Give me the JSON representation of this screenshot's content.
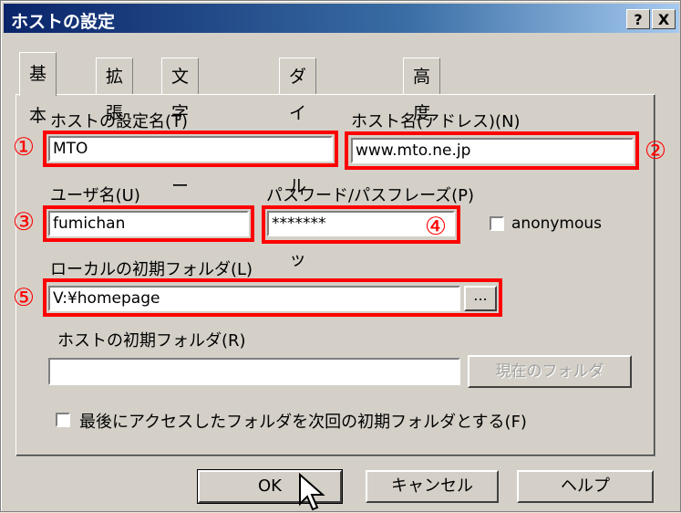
{
  "window": {
    "title": "ホストの設定",
    "help_btn": "?",
    "close_btn": "X"
  },
  "tabs": [
    "基本",
    "拡張",
    "文字コード",
    "ダイアルアップ",
    "高度"
  ],
  "fields": {
    "host_setting_name": {
      "label": "ホストの設定名(T)",
      "value": "MTO"
    },
    "host_name": {
      "label": "ホスト名(アドレス)(N)",
      "value": "www.mto.ne.jp"
    },
    "user_name": {
      "label": "ユーザ名(U)",
      "value": "fumichan"
    },
    "password": {
      "label": "パスワード/パスフレーズ(P)",
      "value": "*******"
    },
    "anonymous_label": "anonymous",
    "local_folder": {
      "label": "ローカルの初期フォルダ(L)",
      "value": "V:¥homepage",
      "browse": "..."
    },
    "host_folder": {
      "label": "ホストの初期フォルダ(R)",
      "value": "",
      "current_btn": "現在のフォルダ"
    },
    "last_folder_checkbox": "最後にアクセスしたフォルダを次回の初期フォルダとする(F)"
  },
  "markers": [
    "①",
    "②",
    "③",
    "④",
    "⑤"
  ],
  "buttons": {
    "ok": "OK",
    "cancel": "キャンセル",
    "help": "ヘルプ"
  },
  "colors": {
    "highlight": "#ff0000",
    "titlebar": "#0a246a"
  }
}
